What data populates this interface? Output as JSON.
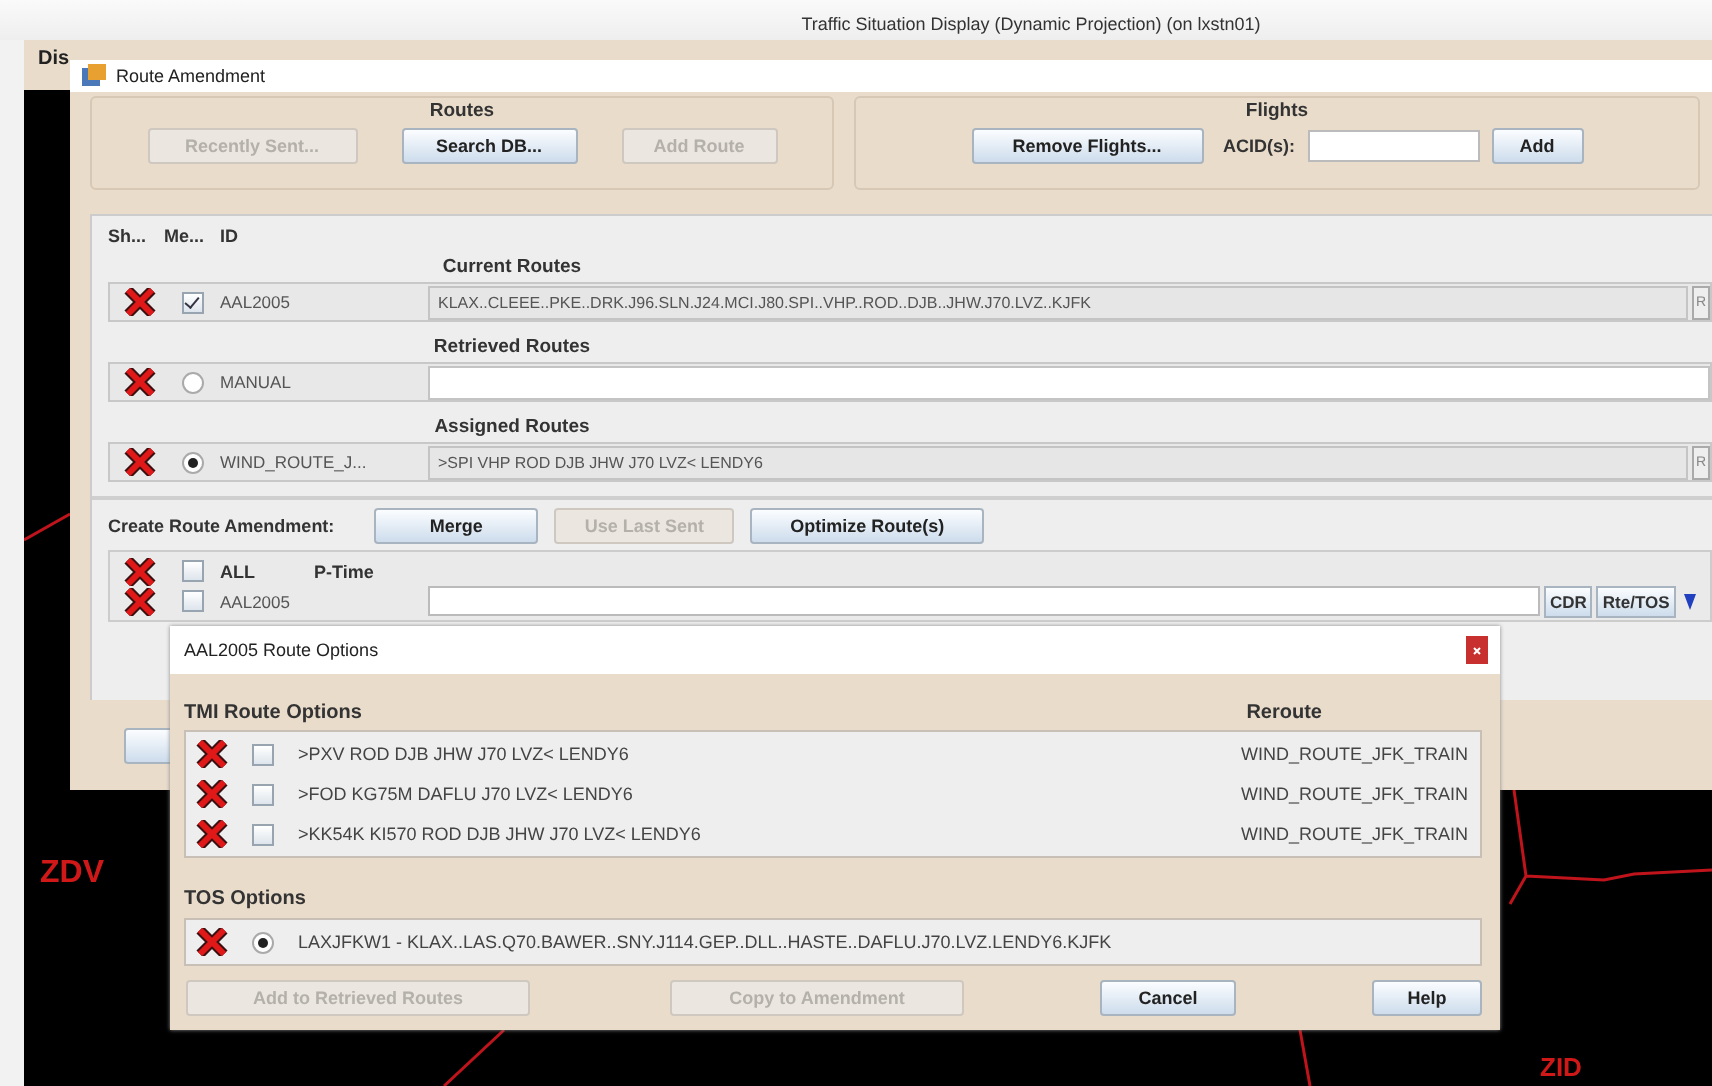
{
  "app_window": {
    "title": "Traffic Situation Display (Dynamic Projection) (on lxstn01)",
    "menu": [
      "Dis"
    ]
  },
  "map": {
    "labels": [
      {
        "text": "ZDV"
      },
      {
        "text": "ZID"
      }
    ]
  },
  "route_amendment": {
    "title": "Route Amendment",
    "routes_group": {
      "title": "Routes",
      "buttons": [
        {
          "label": "Recently Sent...",
          "disabled": true
        },
        {
          "label": "Search DB...",
          "disabled": false
        },
        {
          "label": "Add Route",
          "disabled": true
        }
      ]
    },
    "flights_group": {
      "title": "Flights",
      "remove_button": {
        "label": "Remove Flights...",
        "disabled": false
      },
      "acid_label": "ACID(s):",
      "add_button": {
        "label": "Add",
        "disabled": false
      }
    },
    "columns": [
      "Sh...",
      "Me...",
      "ID"
    ],
    "sections": [
      {
        "title": "Current Routes",
        "rows": [
          {
            "kind": "checkbox",
            "checked": true,
            "id": "AAL2005",
            "route": "KLAX..CLEEE..PKE..DRK.J96.SLN.J24.MCI.J80.SPI..VHP..ROD..DJB..JHW.J70.LVZ..KJFK",
            "editable": false,
            "side_button": "R"
          }
        ]
      },
      {
        "title": "Retrieved Routes",
        "rows": [
          {
            "kind": "radio",
            "selected": false,
            "id": "MANUAL",
            "editable": true
          }
        ]
      },
      {
        "title": "Assigned Routes",
        "rows": [
          {
            "kind": "radio",
            "selected": true,
            "id": "WIND_ROUTE_J...",
            "route": ">SPI VHP ROD DJB JHW J70 LVZ< LENDY6",
            "editable": false,
            "side_button": "R"
          }
        ]
      }
    ],
    "create": {
      "label": "Create Route Amendment:",
      "buttons": [
        {
          "label": "Merge",
          "disabled": false
        },
        {
          "label": "Use Last Sent",
          "disabled": true
        },
        {
          "label": "Optimize Route(s)",
          "disabled": false
        }
      ],
      "all_row": {
        "checked": false,
        "label": "ALL",
        "ptime_label": "P-Time"
      },
      "flight_rows": [
        {
          "checked": false,
          "id": "AAL2005",
          "cdr_button": "CDR",
          "rte_tos_button": "Rte/TOS"
        }
      ]
    }
  },
  "route_options": {
    "title": "AAL2005 Route Options",
    "tmi_heading": "TMI Route Options",
    "reroute_heading": "Reroute",
    "tmi_rows": [
      {
        "checked": false,
        "route": ">PXV ROD DJB JHW J70 LVZ< LENDY6",
        "reroute": "WIND_ROUTE_JFK_TRAIN"
      },
      {
        "checked": false,
        "route": ">FOD KG75M DAFLU J70 LVZ< LENDY6",
        "reroute": "WIND_ROUTE_JFK_TRAIN"
      },
      {
        "checked": false,
        "route": ">KK54K KI570 ROD DJB JHW J70 LVZ< LENDY6",
        "reroute": "WIND_ROUTE_JFK_TRAIN"
      }
    ],
    "tos_heading": "TOS Options",
    "tos_rows": [
      {
        "selected": true,
        "route": "LAXJFKW1 - KLAX..LAS.Q70.BAWER..SNY.J114.GEP..DLL..HASTE..DAFLU.J70.LVZ.LENDY6.KJFK"
      }
    ],
    "buttons": [
      {
        "label": "Add to Retrieved Routes",
        "disabled": true
      },
      {
        "label": "Copy to Amendment",
        "disabled": true
      },
      {
        "label": "Cancel",
        "disabled": false
      },
      {
        "label": "Help",
        "disabled": false
      }
    ]
  }
}
